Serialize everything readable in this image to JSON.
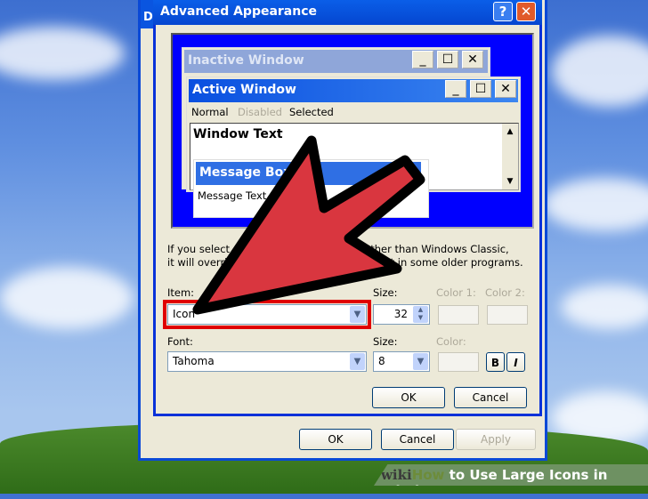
{
  "background_dialog": {
    "title_fragment": "D",
    "ok_label": "OK",
    "cancel_label": "Cancel",
    "apply_label": "Apply"
  },
  "dialog": {
    "title": "Advanced Appearance",
    "help_label": "?",
    "close_label": "✕"
  },
  "preview": {
    "inactive_title": "Inactive Window",
    "active_title": "Active Window",
    "menu": [
      "Normal",
      "Disabled",
      "Selected"
    ],
    "window_text": "Window Text",
    "message_box_title": "Message Box",
    "message_text": "Message Text",
    "controls": {
      "minimize": "_",
      "maximize": "☐",
      "close": "✕"
    }
  },
  "info_text_line1": "If you select a theme or color scheme other than Windows Classic,",
  "info_text_line2": "it will override the following settings, except in some older programs.",
  "item": {
    "label": "Item:",
    "value": "Icon"
  },
  "item_size": {
    "label": "Size:",
    "value": "32"
  },
  "color1": {
    "label": "Color 1:"
  },
  "color2": {
    "label": "Color 2:"
  },
  "font": {
    "label": "Font:",
    "value": "Tahoma"
  },
  "font_size": {
    "label": "Size:",
    "value": "8"
  },
  "font_color": {
    "label": "Color:"
  },
  "bold_label": "B",
  "italic_label": "I",
  "ok_label": "OK",
  "cancel_label": "Cancel",
  "watermark": {
    "wiki": "wiki",
    "how": "How",
    "title": " to Use Large Icons in Windows XP"
  },
  "colors": {
    "arrow": "#d9363f",
    "highlight": "#e00000",
    "titlebar": "#0a55e0"
  }
}
